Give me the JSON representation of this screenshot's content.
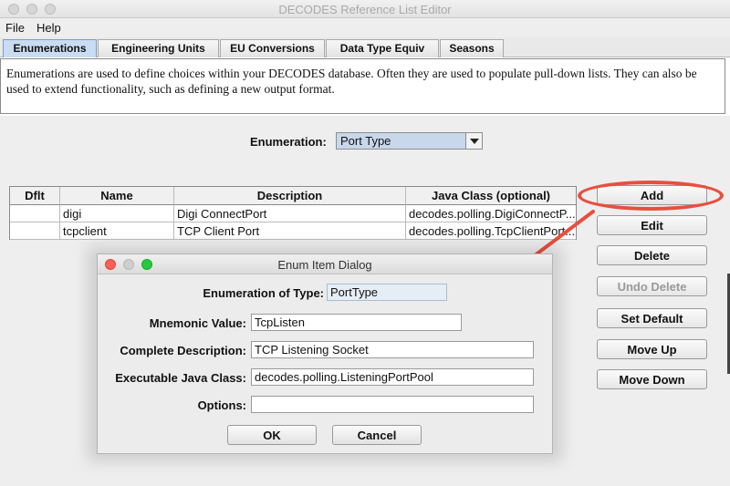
{
  "window": {
    "title": "DECODES Reference List Editor"
  },
  "menu": {
    "items": [
      "File",
      "Help"
    ]
  },
  "tabs": [
    "Enumerations",
    "Engineering Units",
    "EU Conversions",
    "Data Type Equiv",
    "Seasons"
  ],
  "description": "Enumerations are used to define choices within your DECODES database. Often they are used to populate pull-down lists. They can also be used to extend functionality, such as defining a new output format.",
  "enumeration": {
    "label": "Enumeration:",
    "selected": "Port Type"
  },
  "table": {
    "columns": [
      "Dflt",
      "Name",
      "Description",
      "Java Class (optional)"
    ],
    "rows": [
      [
        "",
        "digi",
        "Digi ConnectPort",
        "decodes.polling.DigiConnectP..."
      ],
      [
        "",
        "tcpclient",
        "TCP Client Port",
        "decodes.polling.TcpClientPort..."
      ]
    ]
  },
  "buttons": [
    "Add",
    "Edit",
    "Delete",
    "Undo Delete",
    "Set Default",
    "Move Up",
    "Move Down"
  ],
  "annotation": {
    "color": "#e84f3e"
  },
  "dialog": {
    "title": "Enum Item Dialog",
    "labels": {
      "type": "Enumeration of Type:",
      "mnemonic": "Mnemonic Value:",
      "description": "Complete Description:",
      "java_class": "Executable Java Class:",
      "options": "Options:"
    },
    "values": {
      "type": "PortType",
      "mnemonic": "TcpListen",
      "description": "TCP Listening Socket",
      "java_class": "decodes.polling.ListeningPortPool",
      "options": ""
    },
    "ok": "OK",
    "cancel": "Cancel"
  }
}
